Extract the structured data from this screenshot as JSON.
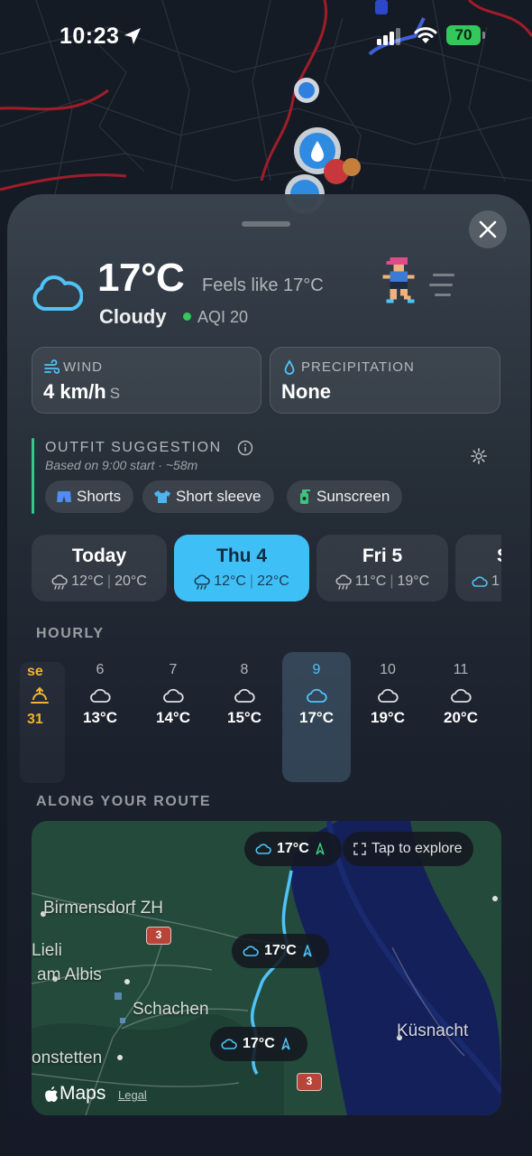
{
  "status_bar": {
    "time": "10:23",
    "battery": "70"
  },
  "current": {
    "temperature": "17°C",
    "feels_like": "Feels like 17°C",
    "condition": "Cloudy",
    "aqi": "AQI 20"
  },
  "wind": {
    "label": "WIND",
    "value": "4 km/h",
    "direction": "S"
  },
  "precipitation": {
    "label": "PRECIPITATION",
    "value": "None"
  },
  "outfit": {
    "title": "OUTFIT SUGGESTION",
    "subtitle": "Based on 9:00 start · ~58m",
    "chips": [
      {
        "label": "Shorts",
        "icon": "shorts-icon"
      },
      {
        "label": "Short sleeve",
        "icon": "tshirt-icon"
      },
      {
        "label": "Sunscreen",
        "icon": "sunscreen-icon"
      }
    ]
  },
  "days": [
    {
      "name": "Today",
      "low": "12°C",
      "high": "20°C",
      "icon": "rain-cloud-icon"
    },
    {
      "name": "Thu 4",
      "low": "12°C",
      "high": "22°C",
      "icon": "rain-cloud-icon",
      "selected": true
    },
    {
      "name": "Fri 5",
      "low": "11°C",
      "high": "19°C",
      "icon": "rain-cloud-icon"
    },
    {
      "name": "S",
      "low": "1",
      "icon": "cloud-icon"
    }
  ],
  "hourly": {
    "title": "HOURLY",
    "sunrise": {
      "label": "se",
      "time": "31"
    },
    "hours": [
      {
        "hour": "6",
        "temp": "13°C"
      },
      {
        "hour": "7",
        "temp": "14°C"
      },
      {
        "hour": "8",
        "temp": "15°C"
      },
      {
        "hour": "9",
        "temp": "17°C",
        "current": true
      },
      {
        "hour": "10",
        "temp": "19°C"
      },
      {
        "hour": "11",
        "temp": "20°C"
      }
    ]
  },
  "route": {
    "title": "ALONG YOUR ROUTE",
    "pills": [
      "17°C",
      "17°C",
      "17°C"
    ],
    "explore": "Tap to explore",
    "places": [
      "Birmensdorf ZH",
      "Lieli",
      "am Albis",
      "Schachen",
      "Küsnacht",
      "onstetten"
    ],
    "road_number": "3",
    "maps_label": "Maps",
    "legal": "Legal"
  },
  "colors": {
    "accent": "#3ec0f6",
    "outfit_bar": "#2ecc8a",
    "aqi_good": "#34c759",
    "sunrise": "#f5b22a"
  }
}
